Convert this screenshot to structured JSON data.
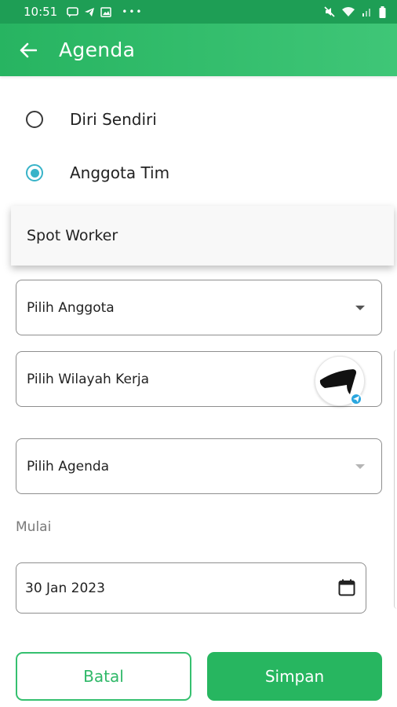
{
  "status_bar": {
    "time": "10:51",
    "left_icons": [
      "message-icon",
      "telegram-icon",
      "gallery-icon",
      "more-dots-icon"
    ],
    "right_icons": [
      "mute-icon",
      "wifi-icon",
      "signal-icon",
      "battery-icon"
    ]
  },
  "app_bar": {
    "title": "Agenda",
    "back_icon": "arrow-left-icon"
  },
  "target_options": [
    {
      "label": "Diri Sendiri",
      "selected": false
    },
    {
      "label": "Anggota Tim",
      "selected": true
    }
  ],
  "dropdown_popup": {
    "items": [
      "Spot Worker"
    ]
  },
  "form": {
    "member_select": {
      "label": "Pilih Anggota"
    },
    "region_select": {
      "label": "Pilih Wilayah Kerja"
    },
    "agenda_select": {
      "label": "Pilih Agenda"
    },
    "start_label": "Mulai",
    "start_date": {
      "value": "30 Jan 2023"
    }
  },
  "actions": {
    "cancel_label": "Batal",
    "save_label": "Simpan"
  },
  "colors": {
    "primary": "#27b660",
    "app_bar_start": "#27b461",
    "app_bar_end": "#3fc677",
    "radio_selected": "#38b3c8",
    "border": "#8e8e8e"
  }
}
